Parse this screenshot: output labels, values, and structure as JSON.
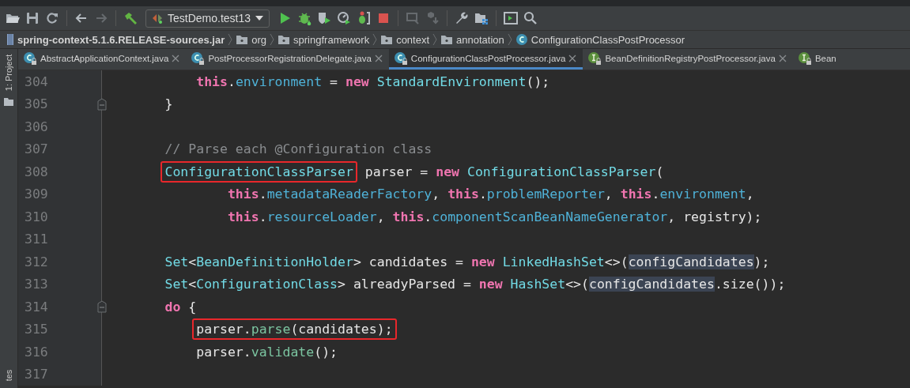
{
  "toolbar": [
    {
      "items": [
        {
          "kind": "open",
          "disabled": false
        },
        {
          "kind": "save",
          "disabled": false
        },
        {
          "kind": "sync",
          "disabled": false
        }
      ]
    },
    {
      "items": [
        {
          "kind": "back",
          "disabled": false
        },
        {
          "kind": "forward",
          "disabled": true
        }
      ]
    },
    {
      "items": [
        {
          "kind": "build",
          "disabled": false
        },
        {
          "kind": "config",
          "label": "TestDemo.test13",
          "disabled": false
        },
        {
          "kind": "run",
          "disabled": false
        },
        {
          "kind": "debug",
          "disabled": false
        },
        {
          "kind": "coverage",
          "disabled": false
        },
        {
          "kind": "profile",
          "disabled": false
        },
        {
          "kind": "attach",
          "disabled": false
        },
        {
          "kind": "stop",
          "disabled": false
        }
      ]
    },
    {
      "items": [
        {
          "kind": "update",
          "disabled": true
        },
        {
          "kind": "deploy",
          "disabled": true
        }
      ]
    },
    {
      "items": [
        {
          "kind": "wrench",
          "disabled": false
        },
        {
          "kind": "structure",
          "disabled": false
        }
      ]
    },
    {
      "items": [
        {
          "kind": "terminal",
          "disabled": false
        },
        {
          "kind": "search",
          "disabled": false
        }
      ]
    }
  ],
  "breadcrumb": [
    {
      "kind": "jar",
      "label": "spring-context-5.1.6.RELEASE-sources.jar"
    },
    {
      "kind": "package",
      "label": "org"
    },
    {
      "kind": "package",
      "label": "springframework"
    },
    {
      "kind": "package",
      "label": "context"
    },
    {
      "kind": "package",
      "label": "annotation"
    },
    {
      "kind": "class",
      "label": "ConfigurationClassPostProcessor"
    }
  ],
  "side_tabs": {
    "top": "1: Project",
    "bottom": "tes"
  },
  "tabs": [
    {
      "kind": "class",
      "label": "AbstractApplicationContext.java",
      "selected": false,
      "closable": true
    },
    {
      "kind": "class",
      "label": "PostProcessorRegistrationDelegate.java",
      "selected": false,
      "closable": true
    },
    {
      "kind": "class",
      "label": "ConfigurationClassPostProcessor.java",
      "selected": true,
      "closable": true
    },
    {
      "kind": "interface",
      "label": "BeanDefinitionRegistryPostProcessor.java",
      "selected": false,
      "closable": true
    },
    {
      "kind": "interface",
      "label": "Bean",
      "selected": false,
      "closable": false
    }
  ],
  "lines": [
    {
      "number": "304",
      "fold_marker": false,
      "kind": "depth3",
      "segments": [
        {
          "boxed": false,
          "tokens": [
            {
              "t": "this",
              "kind": "keyword"
            },
            {
              "t": ".",
              "kind": "plain"
            },
            {
              "t": "environment",
              "kind": "field"
            },
            {
              "t": " = ",
              "kind": "plain"
            },
            {
              "t": "new",
              "kind": "keyword"
            },
            {
              "t": " StandardEnvironment",
              "kind": "type"
            },
            {
              "t": "();",
              "kind": "plain"
            }
          ]
        }
      ]
    },
    {
      "number": "305",
      "fold_marker": true,
      "kind": "depth2",
      "segments": [
        {
          "boxed": false,
          "tokens": [
            {
              "t": "}",
              "kind": "plain"
            }
          ]
        }
      ]
    },
    {
      "number": "306",
      "fold_marker": false
    },
    {
      "number": "307",
      "fold_marker": false,
      "kind": "depth2",
      "segments": [
        {
          "boxed": false,
          "tokens": [
            {
              "t": "// Parse each @Configuration class",
              "kind": "comment"
            }
          ]
        }
      ]
    },
    {
      "number": "308",
      "fold_marker": false,
      "kind": "depth2",
      "segments": [
        {
          "boxed": true,
          "tokens": [
            {
              "t": "ConfigurationClassParser",
              "kind": "type"
            }
          ]
        },
        {
          "boxed": false,
          "tokens": [
            {
              "t": " parser = ",
              "kind": "plain"
            },
            {
              "t": "new",
              "kind": "keyword"
            },
            {
              "t": " ConfigurationClassParser",
              "kind": "type"
            },
            {
              "t": "(",
              "kind": "plain"
            }
          ]
        }
      ]
    },
    {
      "number": "309",
      "fold_marker": false,
      "kind": "depth4",
      "segments": [
        {
          "boxed": false,
          "tokens": [
            {
              "t": "this",
              "kind": "keyword"
            },
            {
              "t": ".",
              "kind": "plain"
            },
            {
              "t": "metadataReaderFactory",
              "kind": "field"
            },
            {
              "t": ", ",
              "kind": "plain"
            },
            {
              "t": "this",
              "kind": "keyword"
            },
            {
              "t": ".",
              "kind": "plain"
            },
            {
              "t": "problemReporter",
              "kind": "field"
            },
            {
              "t": ", ",
              "kind": "plain"
            },
            {
              "t": "this",
              "kind": "keyword"
            },
            {
              "t": ".",
              "kind": "plain"
            },
            {
              "t": "environment",
              "kind": "field"
            },
            {
              "t": ",",
              "kind": "plain"
            }
          ]
        }
      ]
    },
    {
      "number": "310",
      "fold_marker": false,
      "kind": "depth4",
      "segments": [
        {
          "boxed": false,
          "tokens": [
            {
              "t": "this",
              "kind": "keyword"
            },
            {
              "t": ".",
              "kind": "plain"
            },
            {
              "t": "resourceLoader",
              "kind": "field"
            },
            {
              "t": ", ",
              "kind": "plain"
            },
            {
              "t": "this",
              "kind": "keyword"
            },
            {
              "t": ".",
              "kind": "plain"
            },
            {
              "t": "componentScanBeanNameGenerator",
              "kind": "field"
            },
            {
              "t": ", registry);",
              "kind": "plain"
            }
          ]
        }
      ]
    },
    {
      "number": "311",
      "fold_marker": false
    },
    {
      "number": "312",
      "fold_marker": false,
      "kind": "depth2",
      "segments": [
        {
          "boxed": false,
          "tokens": [
            {
              "t": "Set",
              "kind": "type"
            },
            {
              "t": "<",
              "kind": "plain"
            },
            {
              "t": "BeanDefinitionHolder",
              "kind": "type"
            },
            {
              "t": "> candidates = ",
              "kind": "plain"
            },
            {
              "t": "new",
              "kind": "keyword"
            },
            {
              "t": " LinkedHashSet",
              "kind": "type"
            },
            {
              "t": "<>(",
              "kind": "plain"
            },
            {
              "t": "configCandidates",
              "kind": "usage"
            },
            {
              "t": ");",
              "kind": "plain"
            }
          ]
        }
      ]
    },
    {
      "number": "313",
      "fold_marker": false,
      "kind": "depth2",
      "segments": [
        {
          "boxed": false,
          "tokens": [
            {
              "t": "Set",
              "kind": "type"
            },
            {
              "t": "<",
              "kind": "plain"
            },
            {
              "t": "ConfigurationClass",
              "kind": "type"
            },
            {
              "t": "> alreadyParsed = ",
              "kind": "plain"
            },
            {
              "t": "new",
              "kind": "keyword"
            },
            {
              "t": " HashSet",
              "kind": "type"
            },
            {
              "t": "<>(",
              "kind": "plain"
            },
            {
              "t": "configCandidates",
              "kind": "usage"
            },
            {
              "t": ".size());",
              "kind": "plain"
            }
          ]
        }
      ]
    },
    {
      "number": "314",
      "fold_marker": true,
      "kind": "depth2",
      "segments": [
        {
          "boxed": false,
          "tokens": [
            {
              "t": "do",
              "kind": "keyword"
            },
            {
              "t": " {",
              "kind": "plain"
            }
          ]
        }
      ]
    },
    {
      "number": "315",
      "fold_marker": false,
      "kind": "depth3",
      "segments": [
        {
          "boxed": true,
          "tokens": [
            {
              "t": "parser.",
              "kind": "plain"
            },
            {
              "t": "parse",
              "kind": "method"
            },
            {
              "t": "(candidates);",
              "kind": "plain"
            }
          ]
        }
      ]
    },
    {
      "number": "316",
      "fold_marker": false,
      "kind": "depth3",
      "segments": [
        {
          "boxed": false,
          "tokens": [
            {
              "t": "parser.",
              "kind": "plain"
            },
            {
              "t": "validate",
              "kind": "method"
            },
            {
              "t": "();",
              "kind": "plain"
            }
          ]
        }
      ]
    },
    {
      "number": "317",
      "fold_marker": false
    }
  ]
}
